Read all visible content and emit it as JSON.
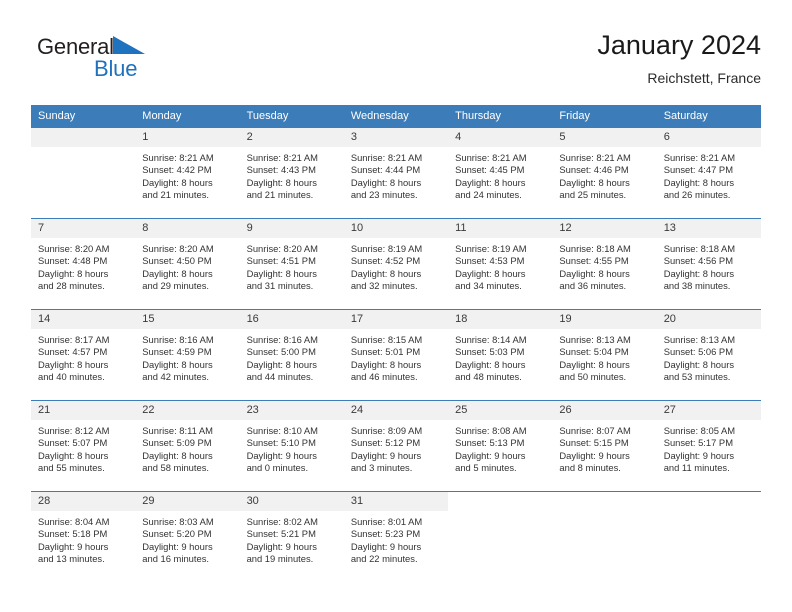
{
  "brand": {
    "name_part1": "General",
    "name_part2": "Blue",
    "triangle_color": "#1f72bd"
  },
  "header": {
    "title": "January 2024",
    "subtitle": "Reichstett, France",
    "accent_color": "#3c7cb8"
  },
  "calendar": {
    "weekday_headers": [
      "Sunday",
      "Monday",
      "Tuesday",
      "Wednesday",
      "Thursday",
      "Friday",
      "Saturday"
    ],
    "weeks": [
      [
        {
          "day": "",
          "sunrise": "",
          "sunset": "",
          "daylight_line1": "",
          "daylight_line2": "",
          "empty": true
        },
        {
          "day": "1",
          "sunrise": "Sunrise: 8:21 AM",
          "sunset": "Sunset: 4:42 PM",
          "daylight_line1": "Daylight: 8 hours",
          "daylight_line2": "and 21 minutes."
        },
        {
          "day": "2",
          "sunrise": "Sunrise: 8:21 AM",
          "sunset": "Sunset: 4:43 PM",
          "daylight_line1": "Daylight: 8 hours",
          "daylight_line2": "and 21 minutes."
        },
        {
          "day": "3",
          "sunrise": "Sunrise: 8:21 AM",
          "sunset": "Sunset: 4:44 PM",
          "daylight_line1": "Daylight: 8 hours",
          "daylight_line2": "and 23 minutes."
        },
        {
          "day": "4",
          "sunrise": "Sunrise: 8:21 AM",
          "sunset": "Sunset: 4:45 PM",
          "daylight_line1": "Daylight: 8 hours",
          "daylight_line2": "and 24 minutes."
        },
        {
          "day": "5",
          "sunrise": "Sunrise: 8:21 AM",
          "sunset": "Sunset: 4:46 PM",
          "daylight_line1": "Daylight: 8 hours",
          "daylight_line2": "and 25 minutes."
        },
        {
          "day": "6",
          "sunrise": "Sunrise: 8:21 AM",
          "sunset": "Sunset: 4:47 PM",
          "daylight_line1": "Daylight: 8 hours",
          "daylight_line2": "and 26 minutes."
        }
      ],
      [
        {
          "day": "7",
          "sunrise": "Sunrise: 8:20 AM",
          "sunset": "Sunset: 4:48 PM",
          "daylight_line1": "Daylight: 8 hours",
          "daylight_line2": "and 28 minutes."
        },
        {
          "day": "8",
          "sunrise": "Sunrise: 8:20 AM",
          "sunset": "Sunset: 4:50 PM",
          "daylight_line1": "Daylight: 8 hours",
          "daylight_line2": "and 29 minutes."
        },
        {
          "day": "9",
          "sunrise": "Sunrise: 8:20 AM",
          "sunset": "Sunset: 4:51 PM",
          "daylight_line1": "Daylight: 8 hours",
          "daylight_line2": "and 31 minutes."
        },
        {
          "day": "10",
          "sunrise": "Sunrise: 8:19 AM",
          "sunset": "Sunset: 4:52 PM",
          "daylight_line1": "Daylight: 8 hours",
          "daylight_line2": "and 32 minutes."
        },
        {
          "day": "11",
          "sunrise": "Sunrise: 8:19 AM",
          "sunset": "Sunset: 4:53 PM",
          "daylight_line1": "Daylight: 8 hours",
          "daylight_line2": "and 34 minutes."
        },
        {
          "day": "12",
          "sunrise": "Sunrise: 8:18 AM",
          "sunset": "Sunset: 4:55 PM",
          "daylight_line1": "Daylight: 8 hours",
          "daylight_line2": "and 36 minutes."
        },
        {
          "day": "13",
          "sunrise": "Sunrise: 8:18 AM",
          "sunset": "Sunset: 4:56 PM",
          "daylight_line1": "Daylight: 8 hours",
          "daylight_line2": "and 38 minutes."
        }
      ],
      [
        {
          "day": "14",
          "sunrise": "Sunrise: 8:17 AM",
          "sunset": "Sunset: 4:57 PM",
          "daylight_line1": "Daylight: 8 hours",
          "daylight_line2": "and 40 minutes."
        },
        {
          "day": "15",
          "sunrise": "Sunrise: 8:16 AM",
          "sunset": "Sunset: 4:59 PM",
          "daylight_line1": "Daylight: 8 hours",
          "daylight_line2": "and 42 minutes."
        },
        {
          "day": "16",
          "sunrise": "Sunrise: 8:16 AM",
          "sunset": "Sunset: 5:00 PM",
          "daylight_line1": "Daylight: 8 hours",
          "daylight_line2": "and 44 minutes."
        },
        {
          "day": "17",
          "sunrise": "Sunrise: 8:15 AM",
          "sunset": "Sunset: 5:01 PM",
          "daylight_line1": "Daylight: 8 hours",
          "daylight_line2": "and 46 minutes."
        },
        {
          "day": "18",
          "sunrise": "Sunrise: 8:14 AM",
          "sunset": "Sunset: 5:03 PM",
          "daylight_line1": "Daylight: 8 hours",
          "daylight_line2": "and 48 minutes."
        },
        {
          "day": "19",
          "sunrise": "Sunrise: 8:13 AM",
          "sunset": "Sunset: 5:04 PM",
          "daylight_line1": "Daylight: 8 hours",
          "daylight_line2": "and 50 minutes."
        },
        {
          "day": "20",
          "sunrise": "Sunrise: 8:13 AM",
          "sunset": "Sunset: 5:06 PM",
          "daylight_line1": "Daylight: 8 hours",
          "daylight_line2": "and 53 minutes."
        }
      ],
      [
        {
          "day": "21",
          "sunrise": "Sunrise: 8:12 AM",
          "sunset": "Sunset: 5:07 PM",
          "daylight_line1": "Daylight: 8 hours",
          "daylight_line2": "and 55 minutes."
        },
        {
          "day": "22",
          "sunrise": "Sunrise: 8:11 AM",
          "sunset": "Sunset: 5:09 PM",
          "daylight_line1": "Daylight: 8 hours",
          "daylight_line2": "and 58 minutes."
        },
        {
          "day": "23",
          "sunrise": "Sunrise: 8:10 AM",
          "sunset": "Sunset: 5:10 PM",
          "daylight_line1": "Daylight: 9 hours",
          "daylight_line2": "and 0 minutes."
        },
        {
          "day": "24",
          "sunrise": "Sunrise: 8:09 AM",
          "sunset": "Sunset: 5:12 PM",
          "daylight_line1": "Daylight: 9 hours",
          "daylight_line2": "and 3 minutes."
        },
        {
          "day": "25",
          "sunrise": "Sunrise: 8:08 AM",
          "sunset": "Sunset: 5:13 PM",
          "daylight_line1": "Daylight: 9 hours",
          "daylight_line2": "and 5 minutes."
        },
        {
          "day": "26",
          "sunrise": "Sunrise: 8:07 AM",
          "sunset": "Sunset: 5:15 PM",
          "daylight_line1": "Daylight: 9 hours",
          "daylight_line2": "and 8 minutes."
        },
        {
          "day": "27",
          "sunrise": "Sunrise: 8:05 AM",
          "sunset": "Sunset: 5:17 PM",
          "daylight_line1": "Daylight: 9 hours",
          "daylight_line2": "and 11 minutes."
        }
      ],
      [
        {
          "day": "28",
          "sunrise": "Sunrise: 8:04 AM",
          "sunset": "Sunset: 5:18 PM",
          "daylight_line1": "Daylight: 9 hours",
          "daylight_line2": "and 13 minutes."
        },
        {
          "day": "29",
          "sunrise": "Sunrise: 8:03 AM",
          "sunset": "Sunset: 5:20 PM",
          "daylight_line1": "Daylight: 9 hours",
          "daylight_line2": "and 16 minutes."
        },
        {
          "day": "30",
          "sunrise": "Sunrise: 8:02 AM",
          "sunset": "Sunset: 5:21 PM",
          "daylight_line1": "Daylight: 9 hours",
          "daylight_line2": "and 19 minutes."
        },
        {
          "day": "31",
          "sunrise": "Sunrise: 8:01 AM",
          "sunset": "Sunset: 5:23 PM",
          "daylight_line1": "Daylight: 9 hours",
          "daylight_line2": "and 22 minutes."
        },
        {
          "day": "",
          "sunrise": "",
          "sunset": "",
          "daylight_line1": "",
          "daylight_line2": "",
          "empty": true,
          "blank": true
        },
        {
          "day": "",
          "sunrise": "",
          "sunset": "",
          "daylight_line1": "",
          "daylight_line2": "",
          "empty": true,
          "blank": true
        },
        {
          "day": "",
          "sunrise": "",
          "sunset": "",
          "daylight_line1": "",
          "daylight_line2": "",
          "empty": true,
          "blank": true
        }
      ]
    ]
  }
}
